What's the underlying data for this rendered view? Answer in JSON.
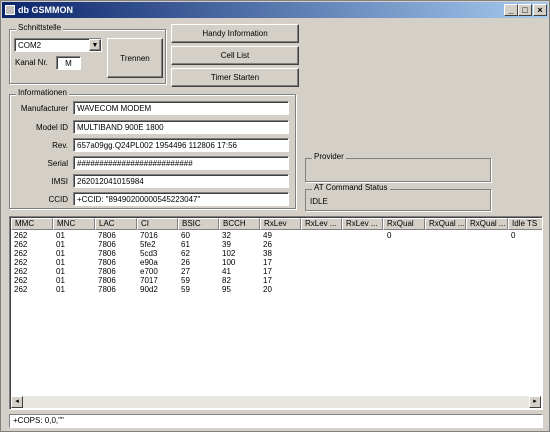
{
  "window": {
    "title": "db GSMMON"
  },
  "titlebar_buttons": {
    "minimize": "_",
    "maximize": "□",
    "close": "×"
  },
  "schnittstelle": {
    "title": "Schnittstelle",
    "com_port": "COM2",
    "kanal_label": "Kanal Nr.",
    "kanal_value": "M",
    "trennen_label": "Trennen"
  },
  "actions": {
    "handy_info": "Handy Information",
    "cell_list": "Cell List",
    "timer": "Timer Starten"
  },
  "informationen": {
    "title": "Informationen",
    "fields": [
      {
        "label": "Manufacturer",
        "value": "WAVECOM MODEM"
      },
      {
        "label": "Model ID",
        "value": "MULTIBAND  900E  1800"
      },
      {
        "label": "Rev.",
        "value": "657a09gg.Q24PL002 1954496 112806 17:56"
      },
      {
        "label": "Serial",
        "value": "##########################"
      },
      {
        "label": "IMSI",
        "value": "262012041015984"
      },
      {
        "label": "CCID",
        "value": "+CCID: \"89490200000545223047\""
      }
    ]
  },
  "provider": {
    "title": "Provider",
    "value": ""
  },
  "at_status": {
    "title": "AT Command Status",
    "value": "IDLE"
  },
  "table": {
    "columns": [
      "MMC",
      "MNC",
      "LAC",
      "CI",
      "BSIC",
      "BCCH",
      "RxLev",
      "RxLev ...",
      "RxLev ...",
      "RxQual",
      "RxQual ...",
      "RxQual ...",
      "Idle TS"
    ],
    "rows": [
      [
        "262",
        "01",
        "7806",
        "7016",
        "60",
        "32",
        "49",
        "",
        "",
        "0",
        "",
        "",
        "0"
      ],
      [
        "262",
        "01",
        "7806",
        "5fe2",
        "61",
        "39",
        "26",
        "",
        "",
        "",
        "",
        "",
        ""
      ],
      [
        "262",
        "01",
        "7806",
        "5cd3",
        "62",
        "102",
        "38",
        "",
        "",
        "",
        "",
        "",
        ""
      ],
      [
        "262",
        "01",
        "7806",
        "e90a",
        "26",
        "100",
        "17",
        "",
        "",
        "",
        "",
        "",
        ""
      ],
      [
        "262",
        "01",
        "7806",
        "e700",
        "27",
        "41",
        "17",
        "",
        "",
        "",
        "",
        "",
        ""
      ],
      [
        "262",
        "01",
        "7806",
        "7017",
        "59",
        "82",
        "17",
        "",
        "",
        "",
        "",
        "",
        ""
      ],
      [
        "262",
        "01",
        "7806",
        "90d2",
        "59",
        "95",
        "20",
        "",
        "",
        "",
        "",
        "",
        ""
      ]
    ]
  },
  "scrollbar": {
    "left_arrow": "◂",
    "right_arrow": "▸"
  },
  "statusbar": {
    "text": "+COPS: 0,0,\"\""
  }
}
